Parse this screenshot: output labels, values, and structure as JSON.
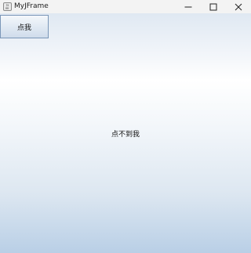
{
  "window": {
    "title": "MyJFrame",
    "icon": "java-app-icon",
    "controls": [
      "minimize-icon",
      "maximize-icon",
      "close-icon"
    ]
  },
  "main": {
    "button_label": "点我",
    "center_label": "点不到我"
  }
}
